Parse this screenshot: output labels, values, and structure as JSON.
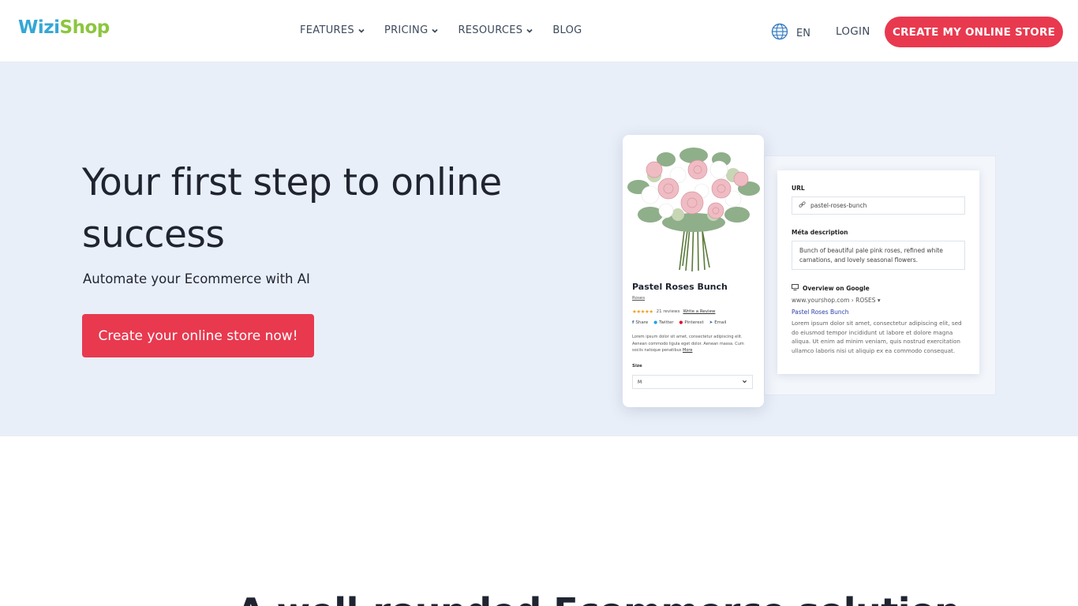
{
  "header": {
    "logo_part1": "Wizi",
    "logo_part2": "Shop",
    "nav": [
      {
        "label": "FEATURES",
        "has_dropdown": true
      },
      {
        "label": "PRICING",
        "has_dropdown": true
      },
      {
        "label": "RESOURCES",
        "has_dropdown": true
      },
      {
        "label": "BLOG",
        "has_dropdown": false
      }
    ],
    "language": "EN",
    "login": "LOGIN",
    "cta": "CREATE MY ONLINE STORE"
  },
  "hero": {
    "title": "Your first step to online success",
    "subtitle": "Automate your Ecommerce with AI",
    "cta": "Create your online store now!"
  },
  "mockup": {
    "product": {
      "name": "Pastel Roses Bunch",
      "category": "Roses",
      "stars": "★★★★★",
      "reviews": "21 reviews",
      "write_review": "Write a Review",
      "share": [
        "Share",
        "Twitter",
        "Pinterest",
        "Email"
      ],
      "description": "Lorem ipsum dolor sit amet, consectetur adipiscing elit. Aenean commodo ligula eget dolor. Aenean massa. Cum sociis natoque penatibus",
      "more": "More",
      "size_label": "Size",
      "size_value": "M"
    },
    "seo": {
      "url_label": "URL",
      "url_value": "pastel-roses-bunch",
      "meta_label": "Méta description",
      "meta_value": "Bunch of beautiful pale pink roses, refined white carnations, and lovely seasonal flowers.",
      "google_label": "Overview on Google",
      "google_url": "www.yourshop.com › ROSES ▾",
      "google_title": "Pastel Roses Bunch",
      "google_desc": "Lorem ipsum dolor sit amet, consectetur adipiscing elit, sed do eiusmod tempor incididunt ut labore et dolore magna aliqua. Ut enim ad minim veniam, quis nostrud exercitation ullamco laboris nisi ut aliquip ex ea commodo consequat."
    }
  },
  "section2": {
    "title_partial": "A well-rounded Ecommerce solution"
  },
  "colors": {
    "accent": "#e8394f",
    "hero_bg": "#e9eff8",
    "logo_blue": "#35a7d6",
    "logo_green": "#8cc63f"
  },
  "icons": {
    "globe": "globe-icon",
    "chevron": "chevron-down-icon",
    "link": "link-icon",
    "monitor": "monitor-icon"
  }
}
